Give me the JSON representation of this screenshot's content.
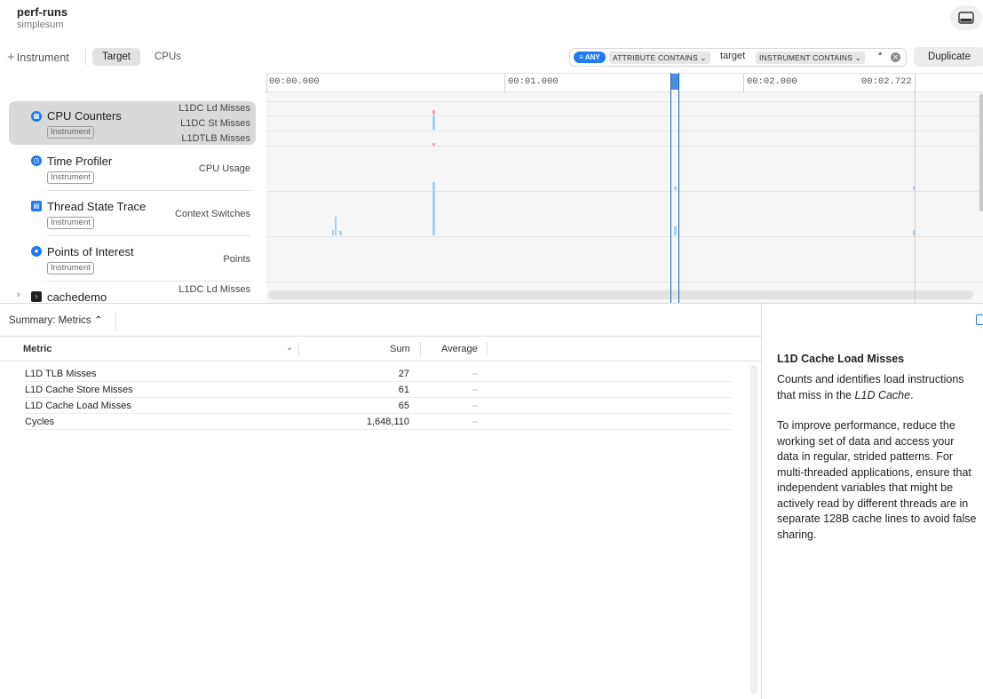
{
  "header": {
    "title": "perf-runs",
    "subtitle": "simplesum",
    "panel_icon": "sidebar-bottom-icon"
  },
  "toolbar": {
    "add_instrument_label": "Instrument",
    "tabs": [
      {
        "label": "Target",
        "selected": true
      },
      {
        "label": "CPUs",
        "selected": false
      }
    ],
    "filter": {
      "any_label": "ANY",
      "token1": "ATTRIBUTE CONTAINS",
      "token1_value": "target",
      "token2": "INSTRUMENT CONTAINS",
      "token2_value": "*"
    },
    "duplicate_label": "Duplicate"
  },
  "ruler": {
    "ticks": [
      "00:00.000",
      "00:01.000",
      "00:02.000",
      "00:02.722"
    ]
  },
  "tracks": [
    {
      "name": "CPU Counters",
      "badge": "Instrument",
      "icon": "cpu-counters-icon",
      "metrics": [
        "L1DC Ld Misses",
        "L1DC St Misses",
        "L1DTLB Misses"
      ],
      "selected": true
    },
    {
      "name": "Time Profiler",
      "badge": "Instrument",
      "icon": "time-profiler-icon",
      "metrics": [
        "CPU Usage"
      ],
      "selected": false
    },
    {
      "name": "Thread State Trace",
      "badge": "Instrument",
      "icon": "thread-state-icon",
      "metrics": [
        "Context Switches"
      ],
      "selected": false
    },
    {
      "name": "Points of Interest",
      "badge": "Instrument",
      "icon": "points-of-interest-icon",
      "metrics": [
        "Points"
      ],
      "selected": false
    },
    {
      "name": "cachedemo",
      "badge": "",
      "icon": "terminal-icon",
      "metrics": [
        "L1DC Ld Misses"
      ],
      "selected": false
    }
  ],
  "summary": {
    "selector_label": "Summary: Metrics ⌃",
    "columns": [
      "Metric",
      "Sum",
      "Average"
    ],
    "rows": [
      {
        "metric": "L1D TLB Misses",
        "sum": "27",
        "average": "–"
      },
      {
        "metric": "L1D Cache Store Misses",
        "sum": "61",
        "average": "–"
      },
      {
        "metric": "L1D Cache Load Misses",
        "sum": "65",
        "average": "–"
      },
      {
        "metric": "Cycles",
        "sum": "1,648,110",
        "average": "–"
      }
    ]
  },
  "detail": {
    "title": "L1D Cache Load Misses",
    "para1_prefix": "Counts and identifies load instructions that miss in the ",
    "para1_em": "L1D Cache",
    "para1_suffix": ".",
    "para2": "To improve performance, reduce the working set of data and access your data in regular, strided patterns. For multi-threaded applications, ensure that independent variables that might be actively read by different threads are in separate 128B cache lines to avoid false sharing."
  },
  "colors": {
    "accent": "#1d78f2",
    "bar_blue": "#a8cff4",
    "bar_red": "#f4a6a6",
    "selection": "#d9d9d9"
  }
}
